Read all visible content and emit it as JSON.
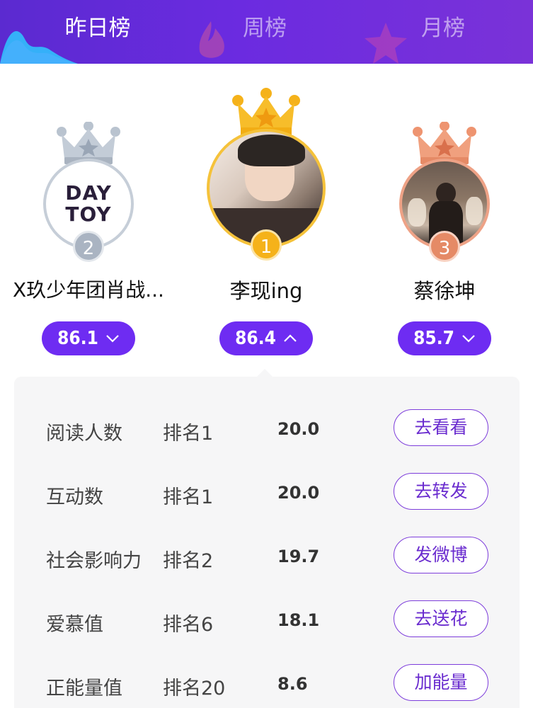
{
  "tabs": [
    {
      "label": "昨日榜",
      "active": true
    },
    {
      "label": "周榜",
      "active": false
    },
    {
      "label": "月榜",
      "active": false
    }
  ],
  "podium": [
    {
      "rank": "2",
      "name": "X玖少年团肖战...",
      "score": "86.1",
      "expanded": false,
      "avatar_text": "DAY TOY",
      "crown_color": "#b9c3cf",
      "accent": "#a9b3c0"
    },
    {
      "rank": "1",
      "name": "李现ing",
      "score": "86.4",
      "expanded": true,
      "crown_color": "#f5b21a",
      "accent": "#f2ad14"
    },
    {
      "rank": "3",
      "name": "蔡徐坤",
      "score": "85.7",
      "expanded": false,
      "crown_color": "#ee9470",
      "accent": "#e58a66"
    }
  ],
  "details": [
    {
      "metric": "阅读人数",
      "rank": "排名1",
      "value": "20.0",
      "action": "去看看"
    },
    {
      "metric": "互动数",
      "rank": "排名1",
      "value": "20.0",
      "action": "去转发"
    },
    {
      "metric": "社会影响力",
      "rank": "排名2",
      "value": "19.7",
      "action": "发微博"
    },
    {
      "metric": "爱慕值",
      "rank": "排名6",
      "value": "18.1",
      "action": "去送花"
    },
    {
      "metric": "正能量值",
      "rank": "排名20",
      "value": "8.6",
      "action": "加能量"
    }
  ]
}
